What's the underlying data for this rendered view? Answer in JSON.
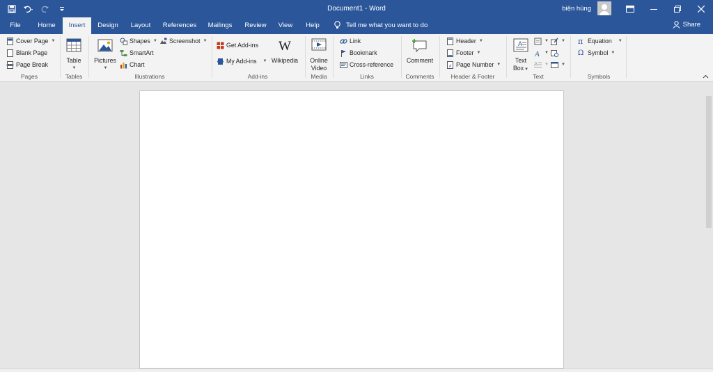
{
  "titlebar": {
    "title": "Document1  -  Word",
    "user_name": "biện hùng"
  },
  "tabs": [
    {
      "label": "File"
    },
    {
      "label": "Home"
    },
    {
      "label": "Insert"
    },
    {
      "label": "Design"
    },
    {
      "label": "Layout"
    },
    {
      "label": "References"
    },
    {
      "label": "Mailings"
    },
    {
      "label": "Review"
    },
    {
      "label": "View"
    },
    {
      "label": "Help"
    }
  ],
  "tell_me": "Tell me what you want to do",
  "share_label": "Share",
  "ribbon": {
    "pages": {
      "label": "Pages",
      "cover_page": "Cover Page",
      "blank_page": "Blank Page",
      "page_break": "Page Break"
    },
    "tables": {
      "label": "Tables",
      "table": "Table"
    },
    "illustrations": {
      "label": "Illustrations",
      "pictures": "Pictures",
      "shapes": "Shapes",
      "smartart": "SmartArt",
      "chart": "Chart",
      "screenshot": "Screenshot"
    },
    "addins": {
      "label": "Add-ins",
      "get_addins": "Get Add-ins",
      "my_addins": "My Add-ins",
      "wikipedia": "Wikipedia"
    },
    "media": {
      "label": "Media",
      "online": "Online",
      "video": "Video"
    },
    "links": {
      "label": "Links",
      "link": "Link",
      "bookmark": "Bookmark",
      "cross_reference": "Cross-reference"
    },
    "comments": {
      "label": "Comments",
      "comment": "Comment"
    },
    "header_footer": {
      "label": "Header & Footer",
      "header": "Header",
      "footer": "Footer",
      "page_number": "Page Number"
    },
    "text": {
      "label": "Text",
      "text": "Text",
      "box": "Box"
    },
    "symbols": {
      "label": "Symbols",
      "equation": "Equation",
      "symbol": "Symbol"
    }
  },
  "colors": {
    "accent": "#2b579a",
    "ribbon": "#f3f3f3",
    "workspace": "#e6e6e6"
  }
}
